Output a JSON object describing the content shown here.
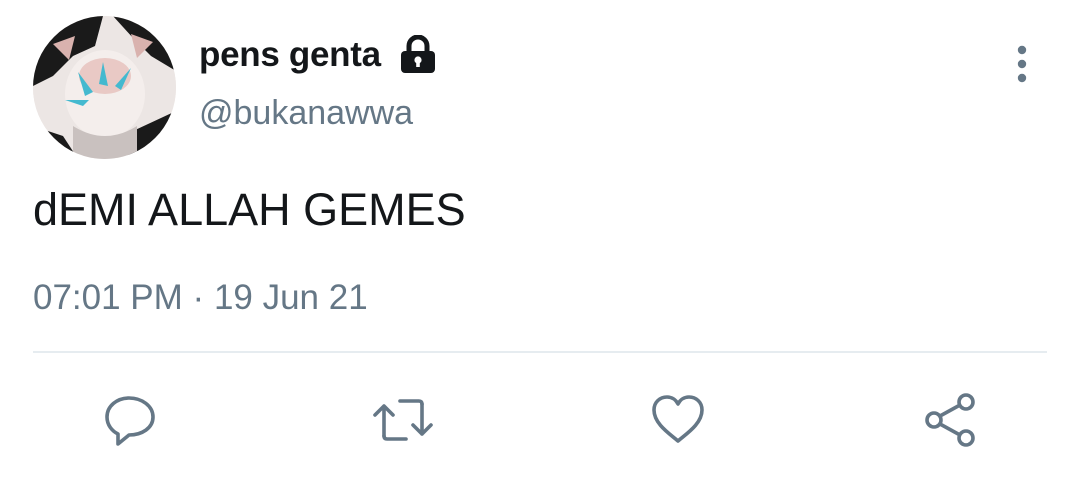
{
  "tweet": {
    "display_name": "pens genta",
    "handle": "@bukanawwa",
    "text": "dEMI ALLAH GEMES",
    "time": "07:01 PM",
    "separator": "·",
    "date": "19 Jun 21",
    "protected": true
  },
  "icons": {
    "lock": "lock-icon",
    "more": "more-vertical-icon",
    "reply": "reply-icon",
    "retweet": "retweet-icon",
    "like": "heart-icon",
    "share": "share-icon"
  },
  "colors": {
    "text_primary": "#14171a",
    "text_secondary": "#657786",
    "divider": "#e6ecf0",
    "icon": "#657786"
  }
}
